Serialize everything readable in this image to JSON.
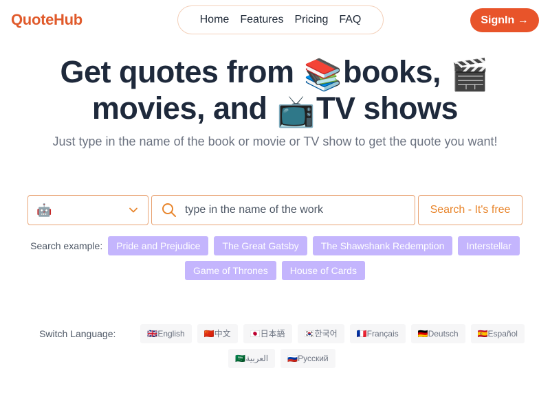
{
  "brand": {
    "name": "QuoteHub"
  },
  "nav": {
    "items": [
      "Home",
      "Features",
      "Pricing",
      "FAQ"
    ]
  },
  "header": {
    "signin_label": "SignIn →"
  },
  "hero": {
    "line1": [
      "Get quotes from ",
      "📚",
      "books, ",
      "🎬"
    ],
    "line2": [
      "movies, and ",
      "📺",
      "TV shows"
    ],
    "subtitle": "Just type in the name of the book or movie or TV show to get the quote you want!"
  },
  "search": {
    "model_icon": "🤖",
    "placeholder": "type in the name of the work",
    "value": "",
    "button_label": "Search - It's free"
  },
  "examples": {
    "label": "Search example:",
    "items": [
      "Pride and Prejudice",
      "The Great Gatsby",
      "The Shawshank Redemption",
      "Interstellar",
      "Game of Thrones",
      "House of Cards"
    ]
  },
  "languages": {
    "label": "Switch Language:",
    "items": [
      "🇬🇧English",
      "🇨🇳中文",
      "🇯🇵日本語",
      "🇰🇷한국어",
      "🇫🇷Français",
      "🇩🇪Deutsch",
      "🇪🇸Español",
      "🇸🇦العربية",
      "🇷🇺Русский"
    ]
  },
  "colors": {
    "brand": "#e05a2b",
    "signin_bg": "#e8542a",
    "chip": "#c4b5fd",
    "border": "#e8a272"
  }
}
